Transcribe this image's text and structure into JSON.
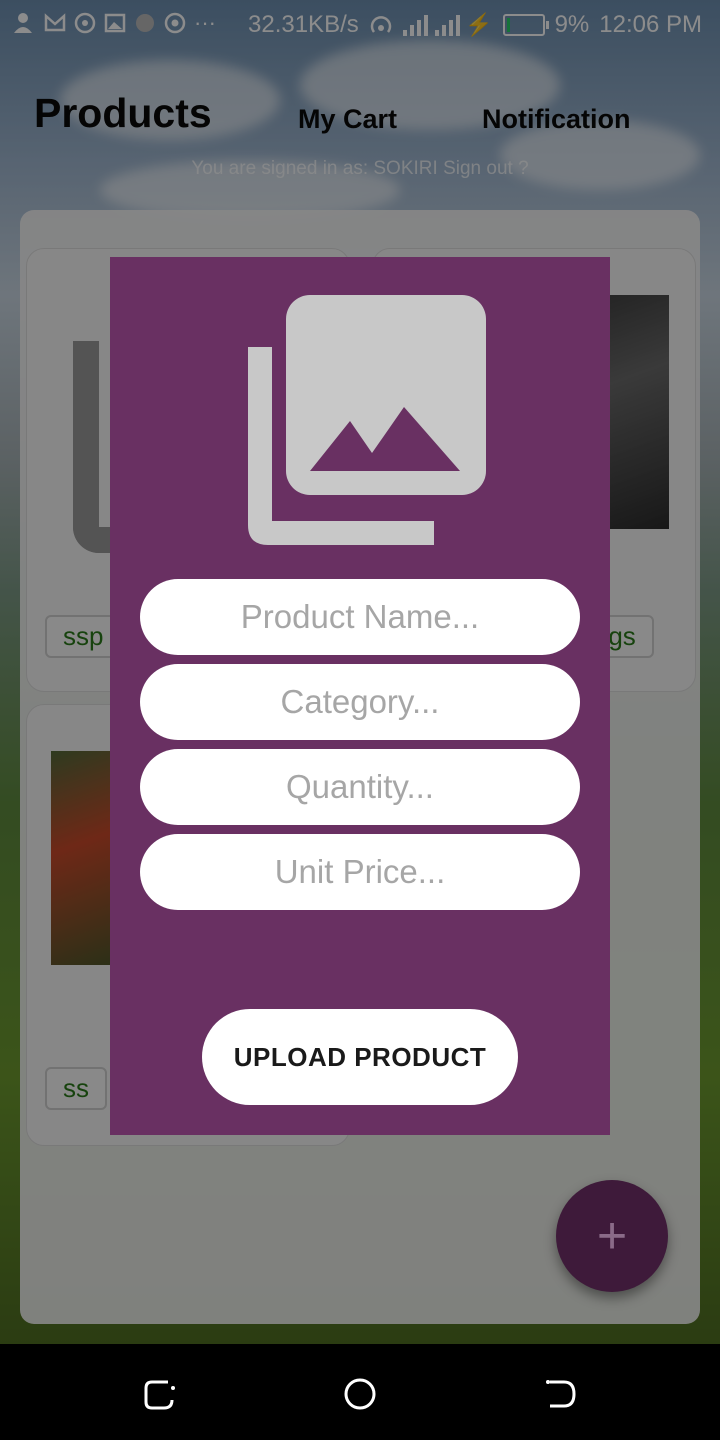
{
  "status_bar": {
    "net_speed": "32.31KB/s",
    "battery": "9%",
    "time": "12:06 PM"
  },
  "header": {
    "title": "Products",
    "tabs": [
      "My Cart",
      "Notification"
    ],
    "signed_in": "You are signed in as: SOKIRI Sign out ?"
  },
  "cards": {
    "tag_left": "ssp",
    "tag_right": "Kgs",
    "tag_left_2": "ss"
  },
  "dialog": {
    "image_picker_icon": "image-gallery-icon",
    "fields": {
      "product_name_placeholder": "Product Name...",
      "category_placeholder": "Category...",
      "quantity_placeholder": "Quantity...",
      "unit_price_placeholder": "Unit Price..."
    },
    "upload_label": "UPLOAD PRODUCT"
  },
  "fab": {
    "label": "+"
  },
  "colors": {
    "dialog_bg": "#693062",
    "fab_bg": "#3e1a3a",
    "tag_text": "#2a7a1a"
  }
}
